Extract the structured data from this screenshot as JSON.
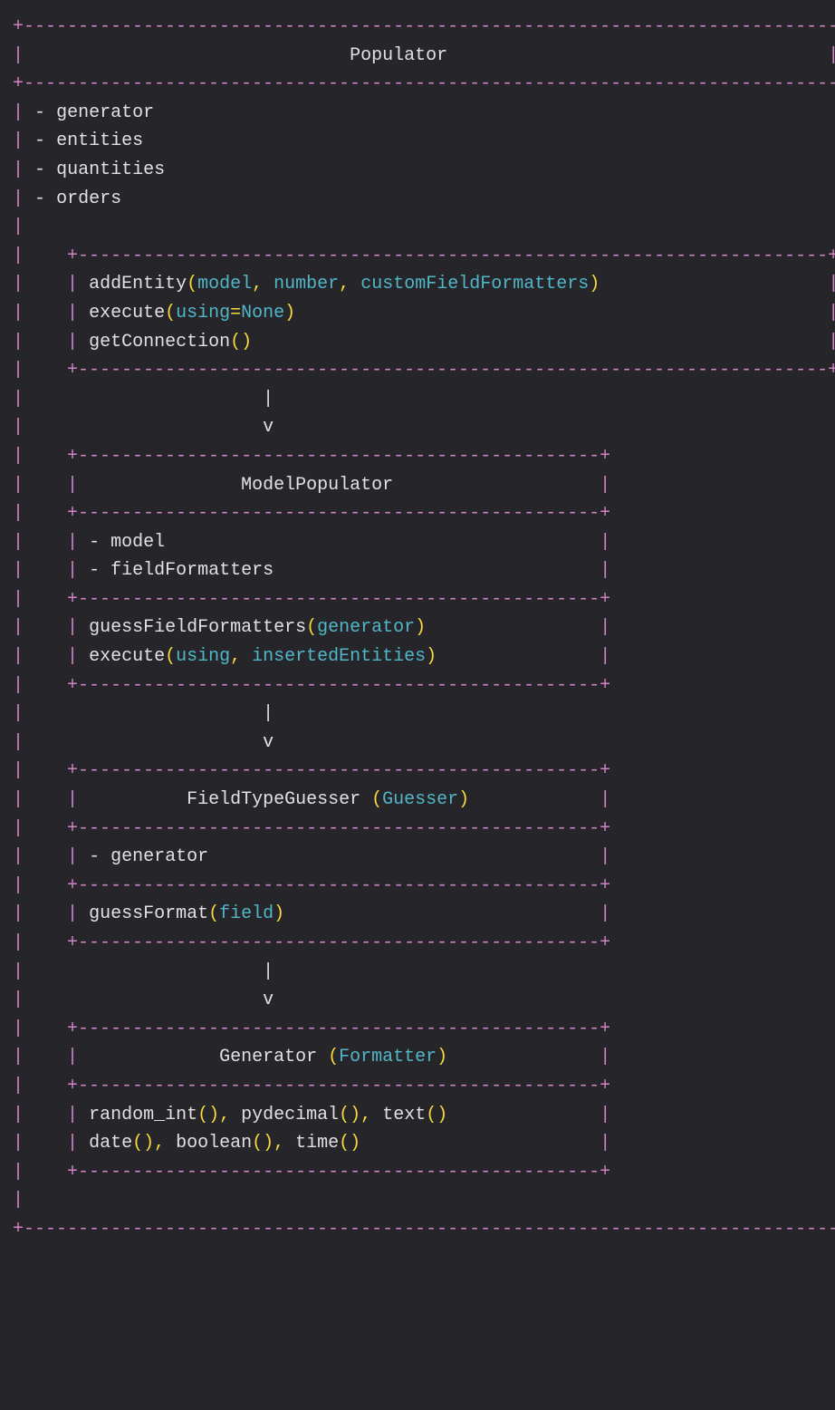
{
  "classes": {
    "populator": {
      "title": "Populator",
      "attributes": [
        "generator",
        "entities",
        "quantities",
        "orders"
      ],
      "methods": [
        {
          "name": "addEntity",
          "params": [
            "model",
            "number",
            "customFieldFormatters"
          ]
        },
        {
          "name": "execute",
          "params": [
            {
              "name": "using",
              "default": "None"
            }
          ]
        },
        {
          "name": "getConnection",
          "params": []
        }
      ]
    },
    "modelPopulator": {
      "title": "ModelPopulator",
      "attributes": [
        "model",
        "fieldFormatters"
      ],
      "methods": [
        {
          "name": "guessFieldFormatters",
          "params": [
            "generator"
          ]
        },
        {
          "name": "execute",
          "params": [
            "using",
            "insertedEntities"
          ]
        }
      ]
    },
    "fieldTypeGuesser": {
      "title": "FieldTypeGuesser",
      "alt": "Guesser",
      "attributes": [
        "generator"
      ],
      "methods": [
        {
          "name": "guessFormat",
          "params": [
            "field"
          ]
        }
      ]
    },
    "generator": {
      "title": "Generator",
      "alt": "Formatter",
      "methodsFlat": [
        [
          "random_int",
          "pydecimal",
          "text"
        ],
        [
          "date",
          "boolean",
          "time"
        ]
      ]
    }
  },
  "flow": [
    "populator",
    "modelPopulator",
    "fieldTypeGuesser",
    "generator"
  ]
}
